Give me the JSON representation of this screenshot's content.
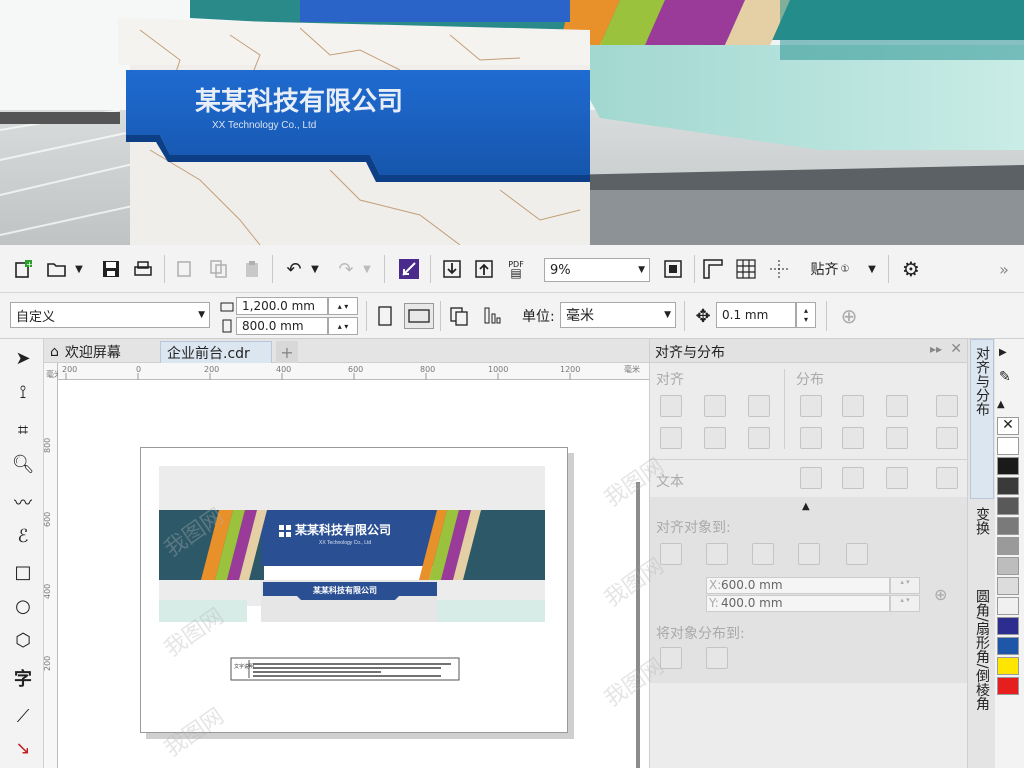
{
  "photo": {
    "company_cn": "某某科技有限公司",
    "company_en": "XX Technology Co., Ltd"
  },
  "toolbar": {
    "zoom": "9%",
    "snap_label": "贴齐",
    "pdf_label": "PDF",
    "more": "»"
  },
  "propbar": {
    "preset": "自定义",
    "width": "1,200.0 mm",
    "height": "800.0 mm",
    "units_label": "单位:",
    "units_value": "毫米",
    "nudge": "0.1 mm"
  },
  "tabs": {
    "welcome": "欢迎屏幕",
    "document": "企业前台.cdr",
    "add": "+"
  },
  "ruler": {
    "h_ticks": [
      "200",
      "0",
      "200",
      "400",
      "600",
      "800",
      "1000",
      "1200"
    ],
    "h_unit": "毫米",
    "v_ticks": [
      "800",
      "600",
      "400",
      "200"
    ],
    "v_unit": "毫米"
  },
  "design": {
    "company_cn": "某某科技有限公司",
    "company_en": "XX Technology Co., Ltd",
    "plate_text": "某某科技有限公司",
    "note_label": "文字说明"
  },
  "panel": {
    "title": "对齐与分布",
    "align": "对齐",
    "distribute": "分布",
    "text": "文本",
    "align_to": "对齐对象到:",
    "x_label": "X:",
    "x_value": "600.0 mm",
    "y_label": "Y:",
    "y_value": "400.0 mm",
    "distribute_to": "将对象分布到:"
  },
  "vtabs": [
    "对齐与分布",
    "变换",
    "圆角/扇形角/倒棱角"
  ],
  "palette": [
    "#ffffff",
    "#1a1a1a",
    "#3a3a3a",
    "#595959",
    "#7a7a7a",
    "#9a9a9a",
    "#bdbdbd",
    "#dcdcdc",
    "#f0f0f0",
    "#2d2d8f",
    "#1e57a8",
    "#ffe600",
    "#e61e1e"
  ],
  "watermark": "我图网"
}
